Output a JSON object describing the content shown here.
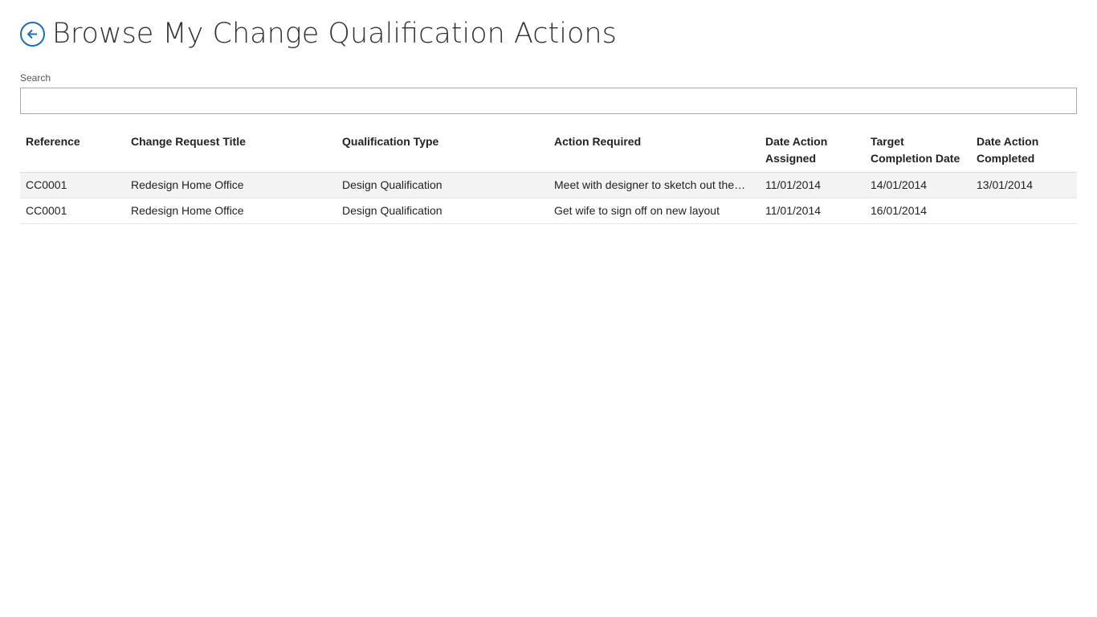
{
  "header": {
    "title": "Browse My Change Qualification Actions",
    "back_icon": "back-arrow-icon",
    "accent_color": "#1d6fb8"
  },
  "search": {
    "label": "Search",
    "value": "",
    "placeholder": ""
  },
  "table": {
    "columns": [
      "Reference",
      "Change Request Title",
      "Qualification Type",
      "Action Required",
      "Date Action Assigned",
      "Target Completion Date",
      "Date Action Completed"
    ],
    "rows": [
      {
        "reference": "CC0001",
        "change_request_title": "Redesign Home Office",
        "qualification_type": "Design Qualification",
        "action_required": "Meet with designer to sketch out the…",
        "date_action_assigned": "11/01/2014",
        "target_completion_date": "14/01/2014",
        "date_action_completed": "13/01/2014"
      },
      {
        "reference": "CC0001",
        "change_request_title": "Redesign Home Office",
        "qualification_type": "Design Qualification",
        "action_required": "Get wife to sign off on new layout",
        "date_action_assigned": "11/01/2014",
        "target_completion_date": "16/01/2014",
        "date_action_completed": ""
      }
    ]
  }
}
